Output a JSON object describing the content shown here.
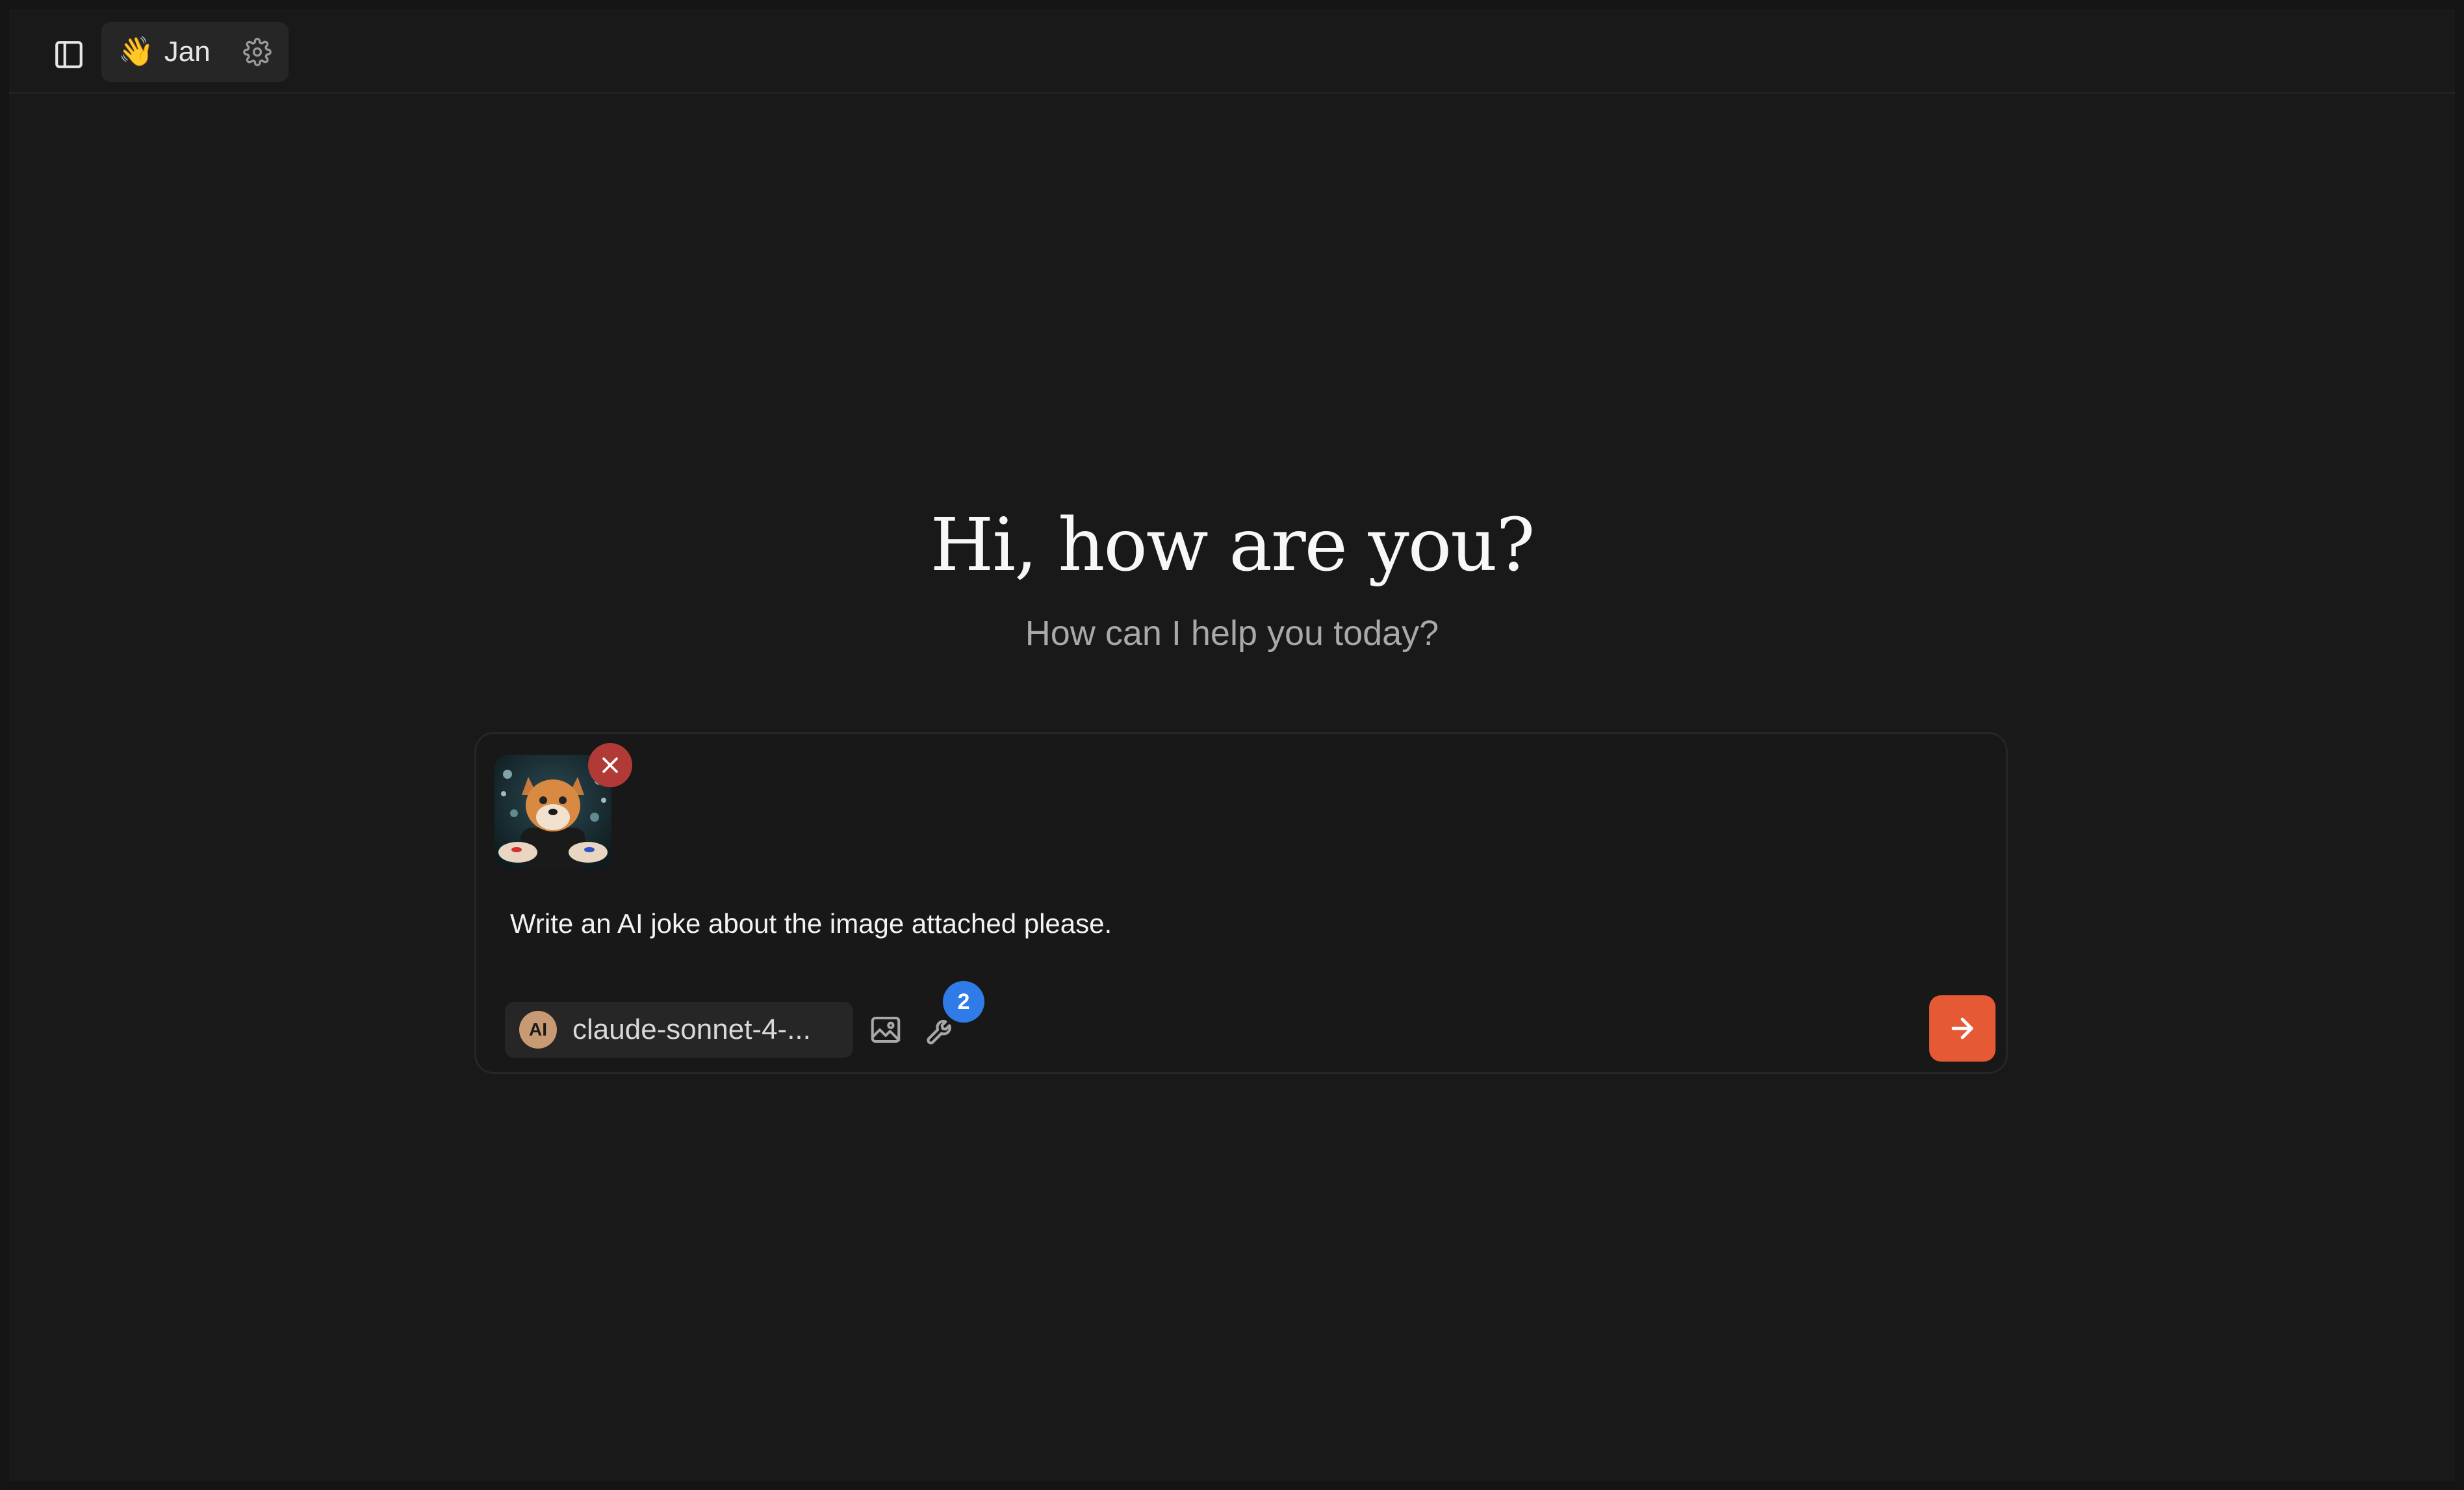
{
  "topbar": {
    "sidebar_toggle_icon": "sidebar-icon",
    "assistant": {
      "emoji": "👋",
      "name": "Jan",
      "settings_icon": "gear-icon"
    }
  },
  "welcome": {
    "title": "Hi, how are you?",
    "subtitle": "How can I help you today?"
  },
  "composer": {
    "attachment": {
      "image": "shiba-dog-with-pills",
      "remove_icon": "close-icon"
    },
    "message": "Write an AI joke about the image attached please.",
    "model": {
      "provider_icon_label": "AI",
      "name": "claude-sonnet-4-..."
    },
    "image_icon": "image-icon",
    "tools": {
      "icon": "wrench-icon",
      "count": "2"
    },
    "send_icon": "arrow-right-icon"
  },
  "colors": {
    "background": "#191919",
    "accent_send": "#e55a35",
    "badge": "#2f7be8",
    "remove": "#b23a36"
  }
}
